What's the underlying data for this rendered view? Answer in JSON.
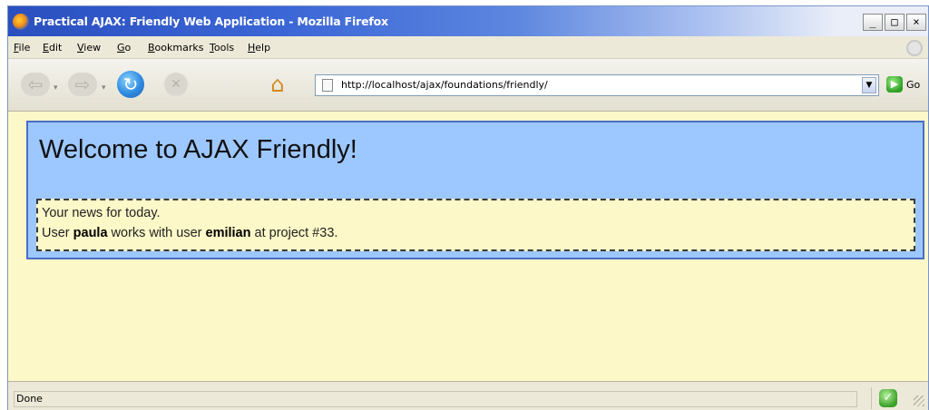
{
  "window": {
    "title": "Practical AJAX: Friendly Web Application - Mozilla Firefox",
    "minimize": "_",
    "maximize": "□",
    "close": "×"
  },
  "menu": {
    "items": [
      {
        "label": "File"
      },
      {
        "label": "Edit"
      },
      {
        "label": "View"
      },
      {
        "label": "Go"
      },
      {
        "label": "Bookmarks"
      },
      {
        "label": "Tools"
      },
      {
        "label": "Help"
      }
    ]
  },
  "toolbar": {
    "back_glyph": "⇦",
    "forward_glyph": "⇨",
    "reload_glyph": "↻",
    "stop_glyph": "✕",
    "home_glyph": "⌂",
    "dropdown_glyph": "▾",
    "url": "http://localhost/ajax/foundations/friendly/",
    "url_dropdown_glyph": "▼",
    "go_glyph": "▶",
    "go_label": "Go"
  },
  "page": {
    "heading": "Welcome to AJAX Friendly!",
    "news_intro": "Your news for today.",
    "news_prefix": "User ",
    "user1": "paula",
    "news_middle": " works with user ",
    "user2": "emilian",
    "news_suffix": " at project #33."
  },
  "status": {
    "text": "Done",
    "security_glyph": "✓"
  },
  "colors": {
    "content_background": "#fdf8c8",
    "panel_background": "#9dc7ff",
    "panel_border": "#4a6ec8"
  }
}
